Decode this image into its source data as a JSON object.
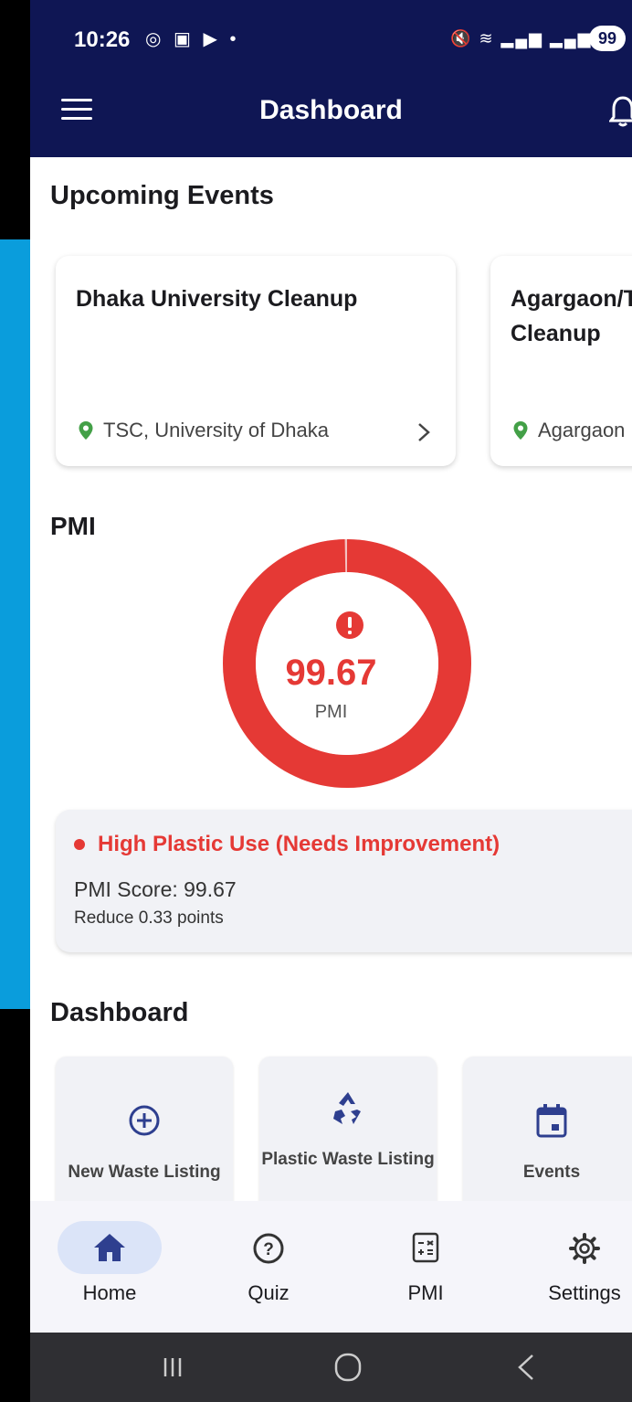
{
  "status_bar": {
    "time": "10:26",
    "left_icons": [
      "instagram-icon",
      "screen-record-icon",
      "youtube-icon",
      "dot-icon"
    ],
    "right_icons": [
      "mute-icon",
      "wifi-icon",
      "signal-icon",
      "signal-icon"
    ],
    "battery": "99"
  },
  "app_bar": {
    "title": "Dashboard"
  },
  "upcoming": {
    "title": "Upcoming Events",
    "events": [
      {
        "title": "Dhaka University Cleanup",
        "location": "TSC, University of Dhaka"
      },
      {
        "title": "Agargaon/Tejgaon Cleanup",
        "title_visible": "Agargaon/​Cleanup",
        "location": "Agargaon"
      }
    ]
  },
  "pmi": {
    "section_title": "PMI",
    "value": "99.67",
    "label": "PMI",
    "gauge_fraction": 0.9967,
    "gauge_color": "#e53935",
    "status_text": "High Plastic Use (Needs Improvement)",
    "score_text": "PMI Score: 99.67",
    "reduce_text": "Reduce 0.33 points"
  },
  "dashboard": {
    "title": "Dashboard",
    "items": [
      {
        "label": "New Waste Listing",
        "icon": "add-circle-icon"
      },
      {
        "label": "Plastic Waste Listing",
        "icon": "recycle-icon"
      },
      {
        "label": "Events",
        "icon": "calendar-icon"
      }
    ]
  },
  "bottom_nav": {
    "items": [
      {
        "label": "Home",
        "icon": "home-icon",
        "active": true
      },
      {
        "label": "Quiz",
        "icon": "help-circle-icon"
      },
      {
        "label": "PMI",
        "icon": "calculator-icon"
      },
      {
        "label": "Settings",
        "icon": "gear-icon"
      }
    ]
  },
  "colors": {
    "app_bar": "#0f1654",
    "accent_red": "#e53935",
    "nav_pill": "#dbe4f8",
    "icon_blue": "#2e3f8f"
  }
}
